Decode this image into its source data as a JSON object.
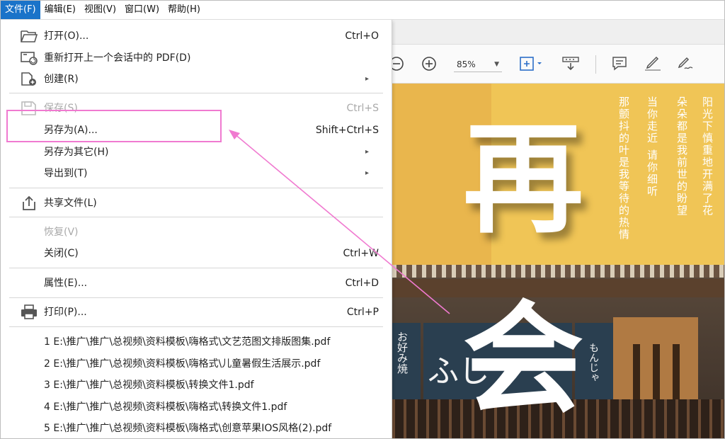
{
  "menubar": {
    "items": [
      "文件(F)",
      "编辑(E)",
      "视图(V)",
      "窗口(W)",
      "帮助(H)"
    ]
  },
  "toolbar": {
    "zoom_value": "85%",
    "icons": [
      "zoom-out-icon",
      "zoom-in-icon",
      "zoom-dropdown-icon",
      "fit-page-icon",
      "scroll-mode-icon",
      "comment-icon",
      "highlight-icon",
      "sign-icon"
    ]
  },
  "file_menu": {
    "open": {
      "label": "打开(O)...",
      "shortcut": "Ctrl+O"
    },
    "reopen": {
      "label": "重新打开上一个会话中的 PDF(D)"
    },
    "create": {
      "label": "创建(R)"
    },
    "save": {
      "label": "保存(S)",
      "shortcut": "Ctrl+S"
    },
    "save_as": {
      "label": "另存为(A)...",
      "shortcut": "Shift+Ctrl+S"
    },
    "save_as_other": {
      "label": "另存为其它(H)"
    },
    "export_to": {
      "label": "导出到(T)"
    },
    "share": {
      "label": "共享文件(L)"
    },
    "revert": {
      "label": "恢复(V)"
    },
    "close": {
      "label": "关闭(C)",
      "shortcut": "Ctrl+W"
    },
    "properties": {
      "label": "属性(E)...",
      "shortcut": "Ctrl+D"
    },
    "print": {
      "label": "打印(P)...",
      "shortcut": "Ctrl+P"
    },
    "recent": [
      "1 E:\\推广\\推广\\总视频\\资料模板\\嗨格式\\文艺范图文排版图集.pdf",
      "2 E:\\推广\\推广\\总视频\\资料模板\\嗨格式\\儿童暑假生活展示.pdf",
      "3 E:\\推广\\推广\\总视频\\资料模板\\转换文件1.pdf",
      "4 E:\\推广\\推广\\总视频\\资料模板\\嗨格式\\转换文件1.pdf",
      "5 E:\\推广\\推广\\总视频\\资料模板\\嗨格式\\创意苹果IOS风格(2).pdf"
    ],
    "submenu_arrow": "▸"
  },
  "document": {
    "char_top": "再",
    "char_bottom": "会",
    "poem_col1": "阳光下慎重地开满了花",
    "poem_col2": "朵朵都是我前世的盼望",
    "poem_col3": "当你走近 请你细听",
    "poem_col4": "那颤抖的叶是我等待的热情",
    "sign_left": "お好み焼",
    "sign_mid": "ふじ",
    "sign_right": "もんじゃ"
  },
  "colors": {
    "menubar_active": "#1a73c9",
    "highlight_box": "#f07ad0",
    "page_yellow": "#f0c556"
  }
}
